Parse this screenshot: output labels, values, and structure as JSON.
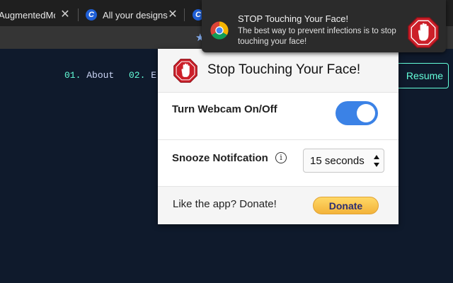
{
  "browser": {
    "tabs": [
      {
        "title": "AugmentedMod",
        "has_favicon": false
      },
      {
        "title": "All your designs",
        "has_favicon": true,
        "favicon_letter": "C"
      },
      {
        "title": "",
        "has_favicon": true,
        "favicon_letter": "C"
      }
    ],
    "close_glyph": "✕"
  },
  "page": {
    "nav": [
      {
        "num": "01.",
        "label": "About"
      },
      {
        "num": "02.",
        "label": "E"
      }
    ],
    "resume_label": "Resume"
  },
  "popup": {
    "title": "Stop Touching Your Face!",
    "webcam_label": "Turn Webcam On/Off",
    "webcam_on": true,
    "snooze_label": "Snooze Notifcation",
    "snooze_value": "15 seconds",
    "footer_text": "Like the app? Donate!",
    "donate_label": "Donate"
  },
  "notification": {
    "title": "STOP Touching Your Face!",
    "body": "The best way to prevent infections is to stop touching your face!"
  },
  "colors": {
    "accent": "#64ffda",
    "toggle_on": "#3b82e6",
    "stop_red": "#cc1f29",
    "page_bg": "#0f1a2c"
  }
}
